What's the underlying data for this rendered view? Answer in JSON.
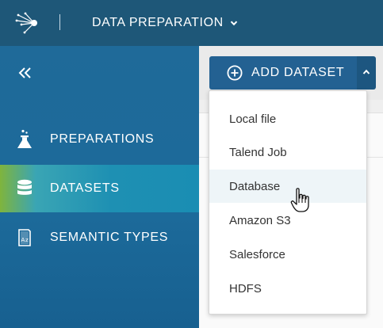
{
  "header": {
    "app_title": "DATA PREPARATION",
    "logo_icon": "talend-logo-icon",
    "switcher_icon": "chevron-down-icon"
  },
  "sidebar": {
    "collapse_icon": "double-chevron-left-icon",
    "items": [
      {
        "label": "PREPARATIONS",
        "icon": "flask-icon",
        "active": false
      },
      {
        "label": "DATASETS",
        "icon": "database-icon",
        "active": true
      },
      {
        "label": "SEMANTIC TYPES",
        "icon": "dictionary-icon",
        "active": false
      }
    ]
  },
  "toolbar": {
    "add_dataset_label": "ADD DATASET",
    "add_icon": "plus-circle-icon",
    "toggle_icon": "chevron-up-icon"
  },
  "dropdown": {
    "items": [
      "Local file",
      "Talend Job",
      "Database",
      "Amazon S3",
      "Salesforce",
      "HDFS"
    ],
    "hovered": "Database"
  },
  "colors": {
    "header": "#1e5778",
    "sidebar": "#1f6a99",
    "active_item": "#1a8db3",
    "active_accent": "#7fb43d",
    "button": "#236192",
    "menu_hover": "#eef5f8"
  }
}
